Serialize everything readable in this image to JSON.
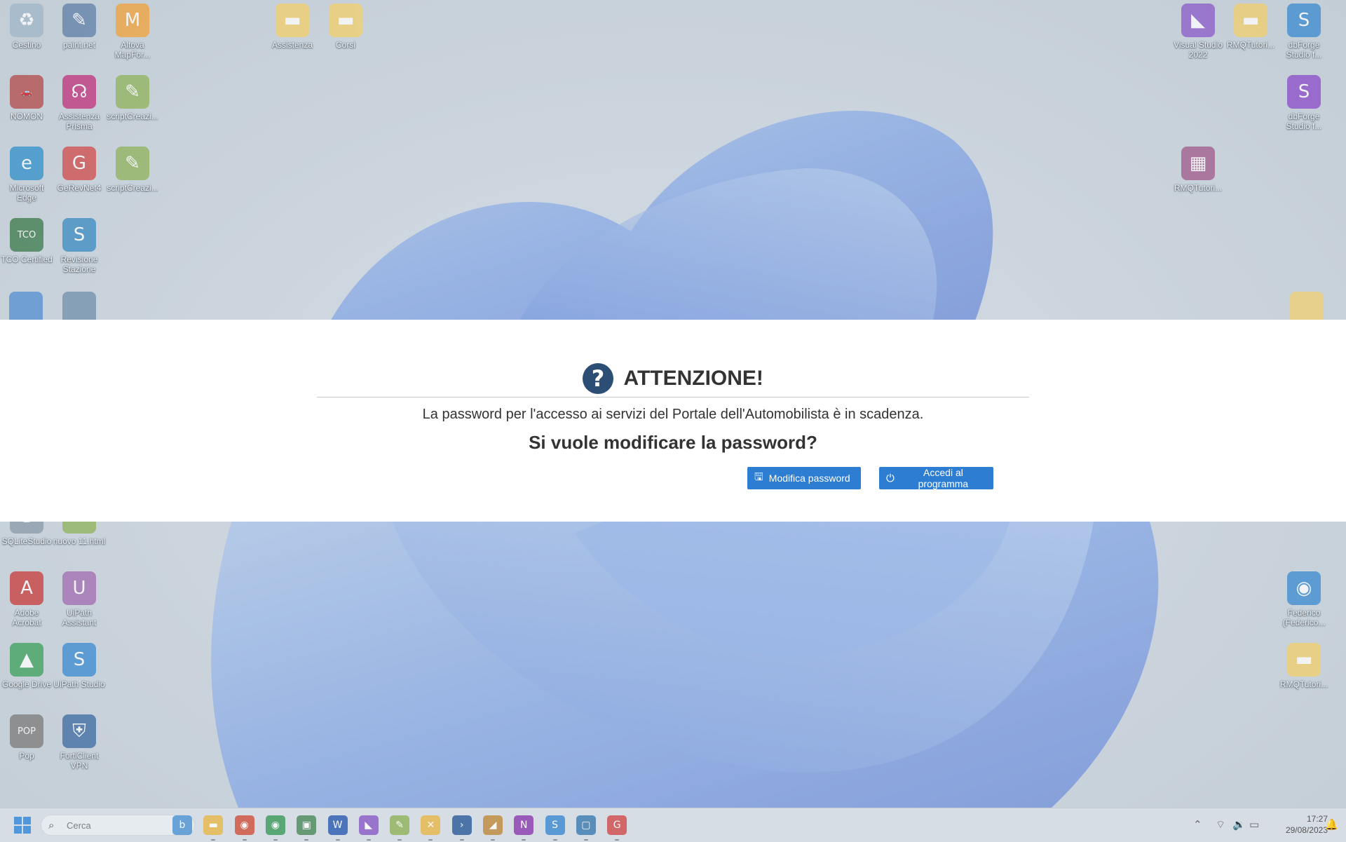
{
  "desktop": {
    "icons_left": [
      {
        "label": "Cestino",
        "icon": "recycle-bin-icon",
        "color": "#9fb7c9",
        "glyph": "♻"
      },
      {
        "label": "paint.net",
        "icon": "paintnet-icon",
        "color": "#5f7fa8",
        "glyph": "✎"
      },
      {
        "label": "Altova MapFor...",
        "icon": "altova-mapforce-icon",
        "color": "#f2a23a",
        "glyph": "M"
      },
      {
        "label": "Assistenza",
        "icon": "folder-icon",
        "color": "#f2cf6b",
        "glyph": "▬"
      },
      {
        "label": "Corsi",
        "icon": "folder-icon",
        "color": "#f2cf6b",
        "glyph": "▬"
      },
      {
        "label": "NOMON",
        "icon": "car-app-icon",
        "color": "#b44a4a",
        "glyph": "🚗"
      },
      {
        "label": "Assistenza Prisma",
        "icon": "headset-icon",
        "color": "#c0307a",
        "glyph": "☊"
      },
      {
        "label": "scriptCreazi...",
        "icon": "script-file-icon",
        "color": "#8fb35a",
        "glyph": "✎"
      },
      {
        "label": "Microsoft Edge",
        "icon": "edge-icon",
        "color": "#2f8fc9",
        "glyph": "e"
      },
      {
        "label": "GeRevNet4",
        "icon": "gerevnet-icon",
        "color": "#d04a4a",
        "glyph": "G"
      },
      {
        "label": "scriptCreazi...",
        "icon": "script-file-icon",
        "color": "#8fb35a",
        "glyph": "✎"
      },
      {
        "label": "TCO Certified",
        "icon": "tco-certified-icon",
        "color": "#3a7a4a",
        "glyph": "TCO"
      },
      {
        "label": "Revisione Stazione",
        "icon": "revisione-stazione-icon",
        "color": "#3a8ac0",
        "glyph": "S"
      },
      {
        "label": "SQLiteStudio",
        "icon": "sqlitestudio-icon",
        "color": "#8a9aa8",
        "glyph": "⛁"
      },
      {
        "label": "nuovo 11.html",
        "icon": "html-file-icon",
        "color": "#8fb35a",
        "glyph": "✎"
      },
      {
        "label": "Adobe Acrobat",
        "icon": "acrobat-icon",
        "color": "#c83a3a",
        "glyph": "A"
      },
      {
        "label": "UiPath Assistant",
        "icon": "uipath-assistant-icon",
        "color": "#a06ab0",
        "glyph": "U"
      },
      {
        "label": "Google Drive",
        "icon": "google-drive-icon",
        "color": "#3aa05a",
        "glyph": "▲"
      },
      {
        "label": "UiPath Studio",
        "icon": "uipath-studio-icon",
        "color": "#3a8ad0",
        "glyph": "S"
      },
      {
        "label": "Pop",
        "icon": "pop-icon",
        "color": "#7a7a7a",
        "glyph": "POP"
      },
      {
        "label": "FortiClient VPN",
        "icon": "forticlient-icon",
        "color": "#3a6aa0",
        "glyph": "⛨"
      }
    ],
    "icons_right": [
      {
        "label": "Visual Studio 2022",
        "icon": "visual-studio-icon",
        "color": "#8a5ac8",
        "glyph": "◣"
      },
      {
        "label": "RMQTutori...",
        "icon": "folder-icon",
        "color": "#f2cf6b",
        "glyph": "▬"
      },
      {
        "label": "dbForge Studio f...",
        "icon": "dbforge-icon",
        "color": "#3a8ad0",
        "glyph": "S"
      },
      {
        "label": "dbForge Studio f...",
        "icon": "dbforge-icon",
        "color": "#8a4ac8",
        "glyph": "S"
      },
      {
        "label": "RMQTutori...",
        "icon": "winrar-icon",
        "color": "#a05a8a",
        "glyph": "▦"
      },
      {
        "label": "Federico (Federico...",
        "icon": "chrome-profile-icon",
        "color": "#3a8ad0",
        "glyph": "◉"
      },
      {
        "label": "RMQTutori...",
        "icon": "folder-icon",
        "color": "#f2cf6b",
        "glyph": "▬"
      }
    ]
  },
  "dialog": {
    "title": "ATTENZIONE!",
    "title_icon": "question-icon",
    "message": "La password per l'accesso ai servizi del Portale dell'Automobilista è in scadenza.",
    "question": "Si vuole modificare la password?",
    "modify_button": "Modifica password",
    "modify_icon": "save-icon",
    "login_button": "Accedi al programma",
    "login_icon": "power-icon",
    "accent": "#2d7dd2",
    "icon_color": "#2c4d74"
  },
  "taskbar": {
    "search_placeholder": "Cerca",
    "apps": [
      {
        "name": "copilot-icon",
        "color": "#4a90d0",
        "glyph": "b"
      },
      {
        "name": "file-explorer-icon",
        "color": "#e8b84a",
        "glyph": "▬"
      },
      {
        "name": "chrome-icon",
        "color": "#d0503a",
        "glyph": "◉"
      },
      {
        "name": "chrome-icon",
        "color": "#3a9a5a",
        "glyph": "◉"
      },
      {
        "name": "remote-desktop-icon",
        "color": "#4a8a5a",
        "glyph": "▣"
      },
      {
        "name": "word-icon",
        "color": "#2a5ab0",
        "glyph": "W"
      },
      {
        "name": "visual-studio-icon",
        "color": "#8a5ac8",
        "glyph": "◣"
      },
      {
        "name": "notepad-icon",
        "color": "#8fb35a",
        "glyph": "✎"
      },
      {
        "name": "tool-icon",
        "color": "#e8b84a",
        "glyph": "✕"
      },
      {
        "name": "powershell-icon",
        "color": "#2a5a9a",
        "glyph": "›"
      },
      {
        "name": "paint-icon",
        "color": "#c08a3a",
        "glyph": "◢"
      },
      {
        "name": "onenote-icon",
        "color": "#8a3ab0",
        "glyph": "N"
      },
      {
        "name": "uipath-studio-icon",
        "color": "#3a8ad0",
        "glyph": "S"
      },
      {
        "name": "window-app-icon",
        "color": "#3a7ab0",
        "glyph": "▢"
      },
      {
        "name": "gerevnet-icon",
        "color": "#d04a4a",
        "glyph": "G"
      }
    ],
    "time": "17:27",
    "date": "29/08/2023"
  }
}
